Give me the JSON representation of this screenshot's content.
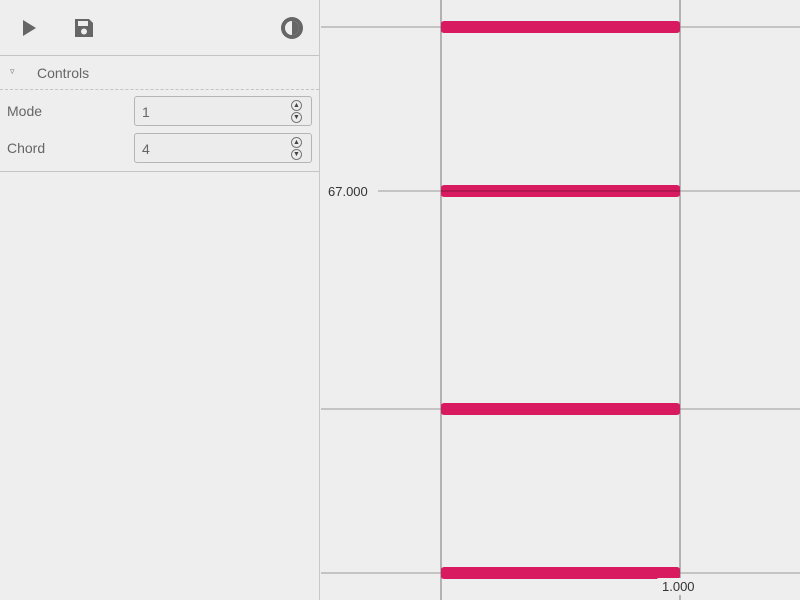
{
  "toolbar": {
    "play_icon": "play-icon",
    "save_icon": "save-icon",
    "theme_icon": "theme-toggle-icon"
  },
  "controls_panel": {
    "title": "Controls",
    "collapse_glyph": "▿",
    "fields": [
      {
        "label": "Mode",
        "value": "1"
      },
      {
        "label": "Chord",
        "value": "4"
      }
    ]
  },
  "plot": {
    "y_tick_label": "67.000",
    "x_tick_label": "1.000",
    "accent_color": "#d81b60"
  },
  "chart_data": {
    "type": "bar",
    "ylabel_tick": "67.000",
    "xlabel_tick": "1.000",
    "series": [
      {
        "values": [
          1.0,
          1.0,
          1.0,
          1.0
        ]
      }
    ],
    "note_rows": 4
  }
}
